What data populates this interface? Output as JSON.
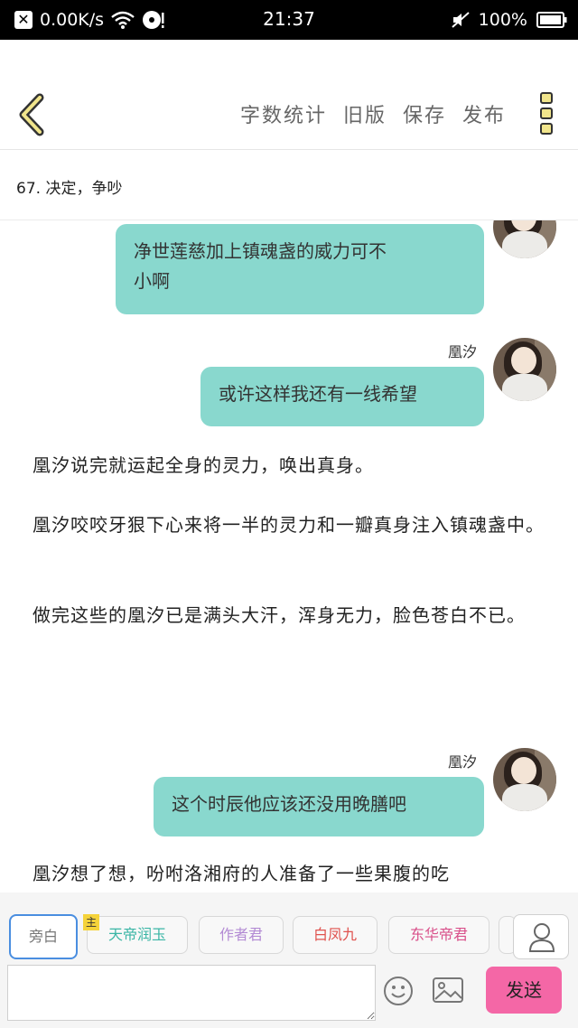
{
  "status_bar": {
    "speed": "0.00K/s",
    "time": "21:37",
    "battery": "100%"
  },
  "toolbar": {
    "word_count": "字数统计",
    "old_version": "旧版",
    "save": "保存",
    "publish": "发布"
  },
  "chapter": {
    "title": "67. 决定，争吵"
  },
  "messages": [
    {
      "speaker": "",
      "text_line1": "净世莲慈加上镇魂盏的威力可不",
      "text_line2": "小啊"
    },
    {
      "speaker": "凰汐",
      "text": "或许这样我还有一线希望"
    },
    {
      "speaker": "凰汐",
      "text": "这个时辰他应该还没用晚膳吧"
    }
  ],
  "narration": [
    "凰汐说完就运起全身的灵力，唤出真身。",
    "凰汐咬咬牙狠下心来将一半的灵力和一瓣真身注入镇魂盏中。",
    "做完这些的凰汐已是满头大汗，浑身无力，脸色苍白不已。",
    "凰汐想了想，吩咐洛湘府的人准备了一些果腹的吃"
  ],
  "roles": [
    {
      "label": "旁白",
      "color": "#777777"
    },
    {
      "label": "天帝润玉",
      "color": "#3bb6a6"
    },
    {
      "label": "作者君",
      "color": "#b38bd4"
    },
    {
      "label": "白凤九",
      "color": "#e0524e"
    },
    {
      "label": "东华帝君",
      "color": "#d9508a"
    }
  ],
  "host_tag": "主",
  "input": {
    "value": "",
    "send_label": "发送"
  }
}
